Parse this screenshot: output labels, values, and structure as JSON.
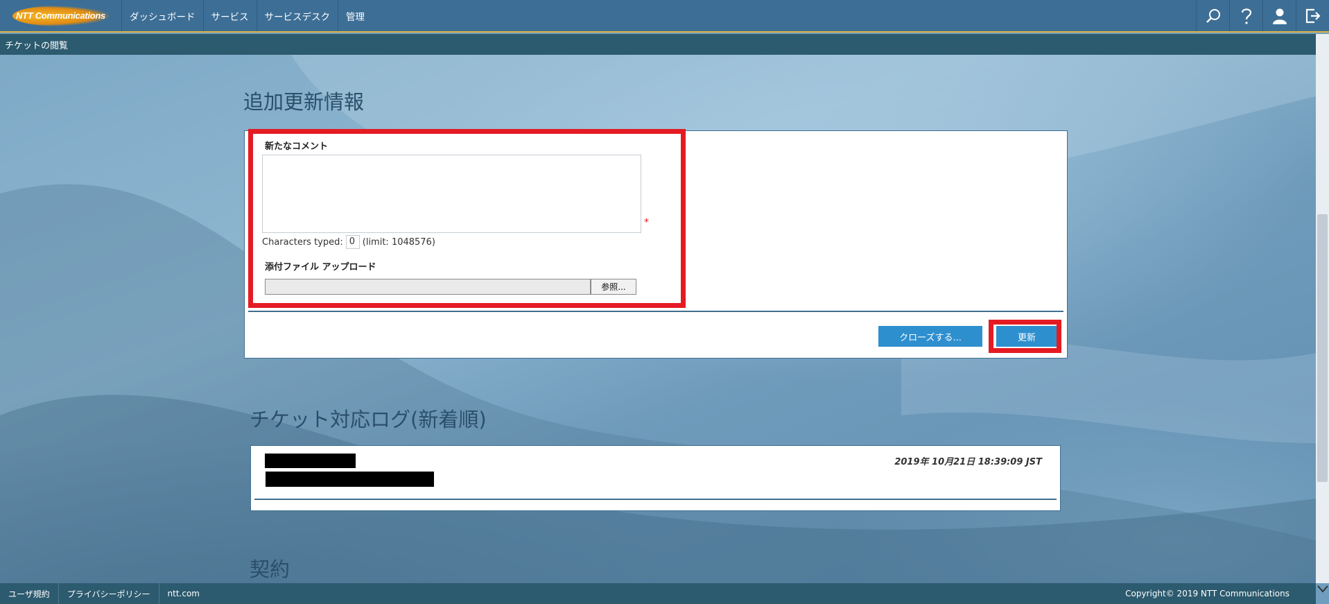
{
  "header": {
    "logo_text": "NTT Communications",
    "nav": [
      "ダッシュボード",
      "サービス",
      "サービスデスク",
      "管理"
    ],
    "icons": [
      "search-icon",
      "help-icon",
      "user-icon",
      "logout-icon"
    ]
  },
  "breadcrumb": "チケットの閲覧",
  "update_section": {
    "title": "追加更新情報",
    "comment_label": "新たなコメント",
    "required_mark": "*",
    "chars_prefix": "Characters typed:",
    "chars_count": "0",
    "chars_limit": "(limit: 1048576)",
    "upload_label": "添付ファイル アップロード",
    "browse_label": "参照...",
    "close_button": "クローズする...",
    "update_button": "更新"
  },
  "log_section": {
    "title": "チケット対応ログ(新着順)",
    "entry_date": "2019年 10月21日 18:39:09 JST"
  },
  "contract_section": {
    "title": "契約"
  },
  "footer": {
    "links": [
      "ユーザ規約",
      "プライバシーポリシー",
      "ntt.com"
    ],
    "copyright": "Copyright© 2019 NTT Communications"
  },
  "colors": {
    "nav_bg": "#3d6e96",
    "nav_accent": "#e0b341",
    "highlight": "#e41b23",
    "button": "#2e8fcf"
  }
}
